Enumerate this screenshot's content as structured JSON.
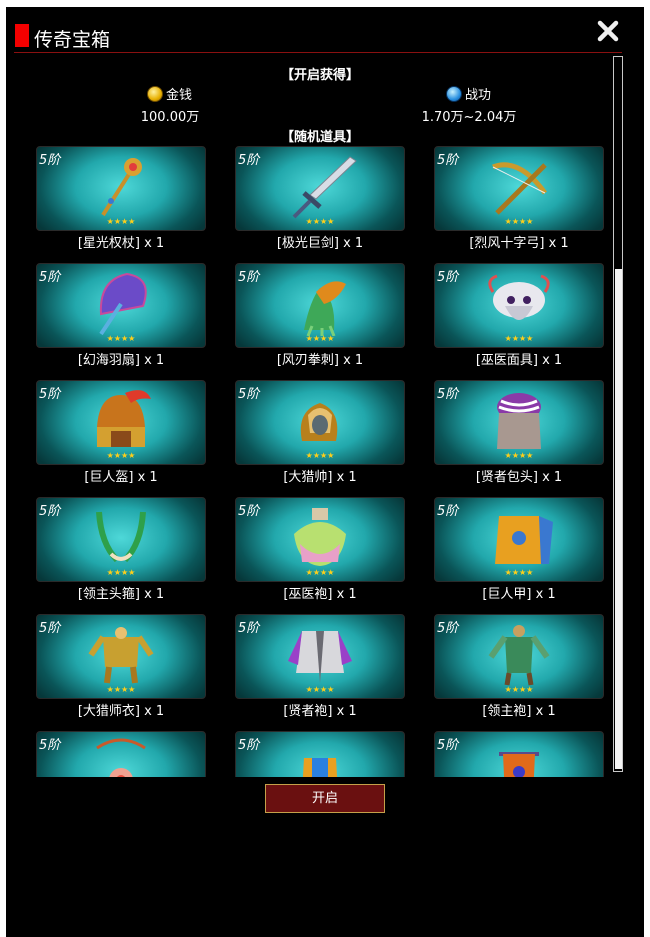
{
  "window": {
    "title": "传奇宝箱"
  },
  "rewards": {
    "header": "【开启获得】",
    "gold": {
      "name": "金钱",
      "value": "100.00万"
    },
    "merit": {
      "name": "战功",
      "value": "1.70万~2.04万"
    }
  },
  "random_items": {
    "header": "【随机道具】",
    "items": [
      {
        "tier": "5阶",
        "stars": "★★★★",
        "label": "[星光权杖] x 1",
        "icon": "scepter"
      },
      {
        "tier": "5阶",
        "stars": "★★★★",
        "label": "[极光巨剑] x 1",
        "icon": "sword"
      },
      {
        "tier": "5阶",
        "stars": "★★★★",
        "label": "[烈风十字弓] x 1",
        "icon": "crossbow"
      },
      {
        "tier": "5阶",
        "stars": "★★★★",
        "label": "[幻海羽扇] x 1",
        "icon": "feather-fan"
      },
      {
        "tier": "5阶",
        "stars": "★★★★",
        "label": "[风刃拳刺] x 1",
        "icon": "claw"
      },
      {
        "tier": "5阶",
        "stars": "★★★★",
        "label": "[巫医面具] x 1",
        "icon": "mask"
      },
      {
        "tier": "5阶",
        "stars": "★★★★",
        "label": "[巨人盔] x 1",
        "icon": "helmet"
      },
      {
        "tier": "5阶",
        "stars": "★★★★",
        "label": "[大猎帅] x 1",
        "icon": "hunter-helmet"
      },
      {
        "tier": "5阶",
        "stars": "★★★★",
        "label": "[贤者包头] x 1",
        "icon": "turban"
      },
      {
        "tier": "5阶",
        "stars": "★★★★",
        "label": "[领主头箍] x 1",
        "icon": "horns"
      },
      {
        "tier": "5阶",
        "stars": "★★★★",
        "label": "[巫医袍] x 1",
        "icon": "shaman-robe"
      },
      {
        "tier": "5阶",
        "stars": "★★★★",
        "label": "[巨人甲] x 1",
        "icon": "armor"
      },
      {
        "tier": "5阶",
        "stars": "★★★★",
        "label": "[大猎师衣] x 1",
        "icon": "hunter-coat"
      },
      {
        "tier": "5阶",
        "stars": "★★★★",
        "label": "[贤者袍] x 1",
        "icon": "sage-robe"
      },
      {
        "tier": "5阶",
        "stars": "★★★★",
        "label": "[领主袍] x 1",
        "icon": "lord-robe"
      },
      {
        "tier": "5阶",
        "stars": "",
        "label": "",
        "icon": "necklace"
      },
      {
        "tier": "5阶",
        "stars": "",
        "label": "",
        "icon": "shield"
      },
      {
        "tier": "5阶",
        "stars": "",
        "label": "",
        "icon": "banner"
      }
    ]
  },
  "open_button": "开启",
  "colors": {
    "title_marker": "#f40000",
    "button_bg": "#6a1010",
    "button_border": "#c4a04a",
    "card_glow": "#4ed8d8",
    "stars": "#ffcf1a"
  }
}
